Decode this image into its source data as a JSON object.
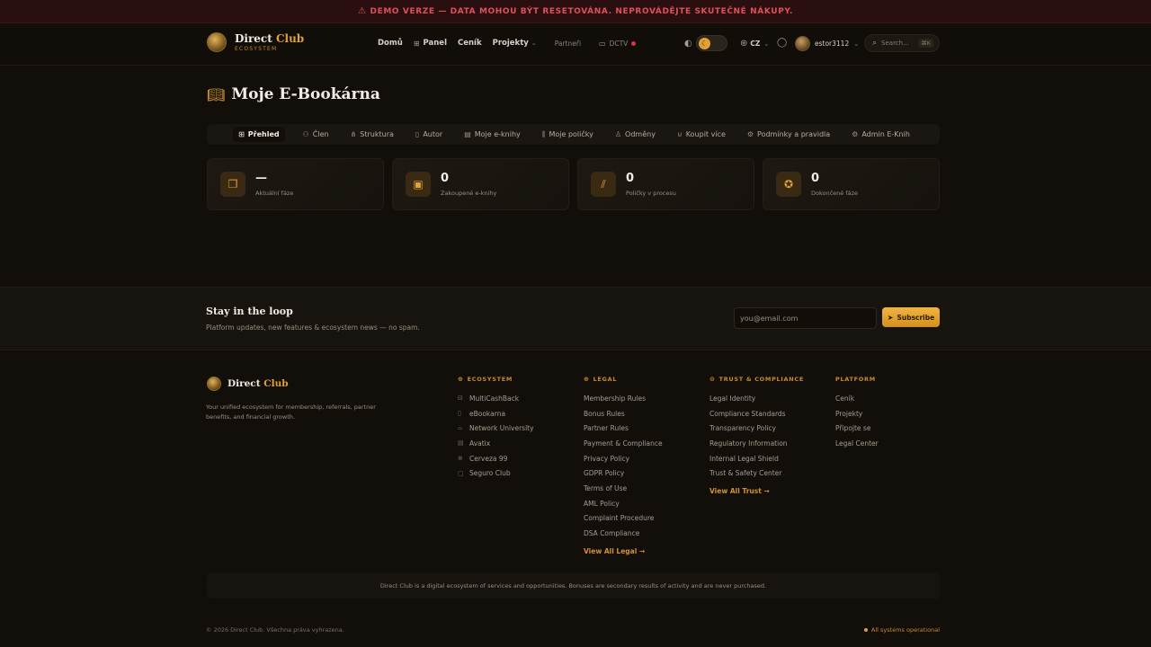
{
  "banner": {
    "text": "DEMO VERZE — DATA MOHOU BÝT RESETOVÁNA. NEPROVÁDĚJTE SKUTEČNÉ NÁKUPY.",
    "icon": "warning-triangle-icon"
  },
  "header": {
    "brand": {
      "name_part1": "Direct",
      "name_part2": "Club",
      "sub": "ECOSYSTEM"
    },
    "nav": {
      "home": "Domů",
      "panel": "Panel",
      "pricing": "Ceník",
      "projects": "Projekty",
      "partners": "Partneři",
      "dctv": "DCTV"
    },
    "lang": "CZ",
    "user": "estor3112",
    "search": {
      "placeholder": "Search...",
      "shortcut": "⌘K"
    }
  },
  "page": {
    "title": "Moje E-Bookárna"
  },
  "tabs": [
    {
      "label": "Přehled",
      "icon": "grid-icon"
    },
    {
      "label": "Člen",
      "icon": "users-icon"
    },
    {
      "label": "Struktura",
      "icon": "network-icon"
    },
    {
      "label": "Autor",
      "icon": "book-icon"
    },
    {
      "label": "Moje e-knihy",
      "icon": "ebook-icon"
    },
    {
      "label": "Moje poličky",
      "icon": "shelf-icon"
    },
    {
      "label": "Odměny",
      "icon": "award-icon"
    },
    {
      "label": "Koupit více",
      "icon": "cart-icon"
    },
    {
      "label": "Podmínky a pravidla",
      "icon": "gear-icon"
    },
    {
      "label": "Admin E-Knih",
      "icon": "admin-gear-icon"
    }
  ],
  "stats": [
    {
      "value": "—",
      "label": "Aktuální fáze",
      "icon": "open-book-icon"
    },
    {
      "value": "0",
      "label": "Zakoupené e-knihy",
      "icon": "book-icon"
    },
    {
      "value": "0",
      "label": "Poličky v procesu",
      "icon": "library-icon"
    },
    {
      "value": "0",
      "label": "Dokončené fáze",
      "icon": "award-icon"
    }
  ],
  "newsletter": {
    "title": "Stay in the loop",
    "desc": "Platform updates, new features & ecosystem news — no spam.",
    "placeholder": "you@email.com",
    "button": "Subscribe"
  },
  "footer": {
    "brand_part1": "Direct",
    "brand_part2": "Club",
    "desc": "Your unified ecosystem for membership, referrals, partner benefits, and financial growth.",
    "ecosystem": {
      "head": "ECOSYSTEM",
      "links": [
        "MultiCashBack",
        "eBookarna",
        "Network University",
        "Avatix",
        "Cerveza 99",
        "Seguro Club"
      ]
    },
    "legal": {
      "head": "LEGAL",
      "links": [
        "Membership Rules",
        "Bonus Rules",
        "Partner Rules",
        "Payment & Compliance",
        "Privacy Policy",
        "GDPR Policy",
        "Terms of Use",
        "AML Policy",
        "Complaint Procedure",
        "DSA Compliance"
      ],
      "more": "View All Legal →"
    },
    "trust": {
      "head": "TRUST & COMPLIANCE",
      "links": [
        "Legal Identity",
        "Compliance Standards",
        "Transparency Policy",
        "Regulatory Information",
        "Internal Legal Shield",
        "Trust & Safety Center"
      ],
      "more": "View All Trust →"
    },
    "platform": {
      "head": "PLATFORM",
      "links": [
        "Ceník",
        "Projekty",
        "Připojte se",
        "Legal Center"
      ]
    },
    "disclaimer": "Direct Club is a digital ecosystem of services and opportunities. Bonuses are secondary results of activity and are never purchased.",
    "copyright": "© 2026 Direct Club. Všechna práva vyhrazena.",
    "status": "All systems operational"
  },
  "colors": {
    "accent": "#e0a234",
    "background": "#120f0b",
    "banner": "#e0505a"
  }
}
